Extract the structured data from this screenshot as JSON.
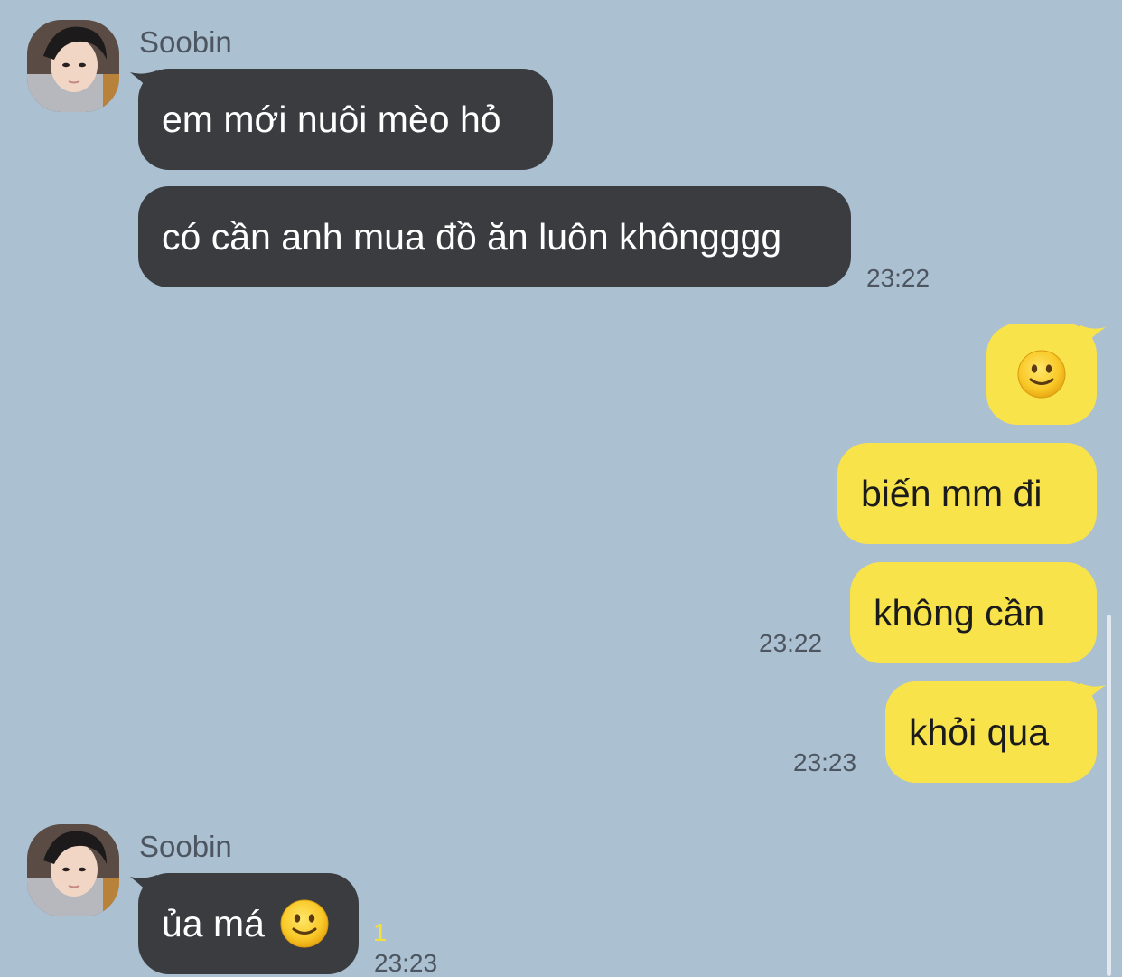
{
  "chat": {
    "groups": [
      {
        "sender": "Soobin",
        "messages": [
          "em mới nuôi mèo hỏ",
          "có cần anh mua đồ ăn luôn khôngggg"
        ],
        "time": "23:22"
      },
      {
        "sender": "Soobin",
        "message_text": "ủa má",
        "unread_count": "1",
        "time": "23:23"
      }
    ],
    "outgoing": {
      "messages": [
        "biến mm đi",
        "không cần",
        "khỏi qua"
      ],
      "time_1": "23:22",
      "time_2": "23:23"
    }
  },
  "colors": {
    "background": "#abc0d1",
    "incoming_bubble": "#3a3c3f",
    "outgoing_bubble": "#f8e34b",
    "unread": "#f4e03d"
  },
  "icons": {
    "emoji": "slightly-smiling-face-icon",
    "avatar": "user-avatar-photo"
  }
}
